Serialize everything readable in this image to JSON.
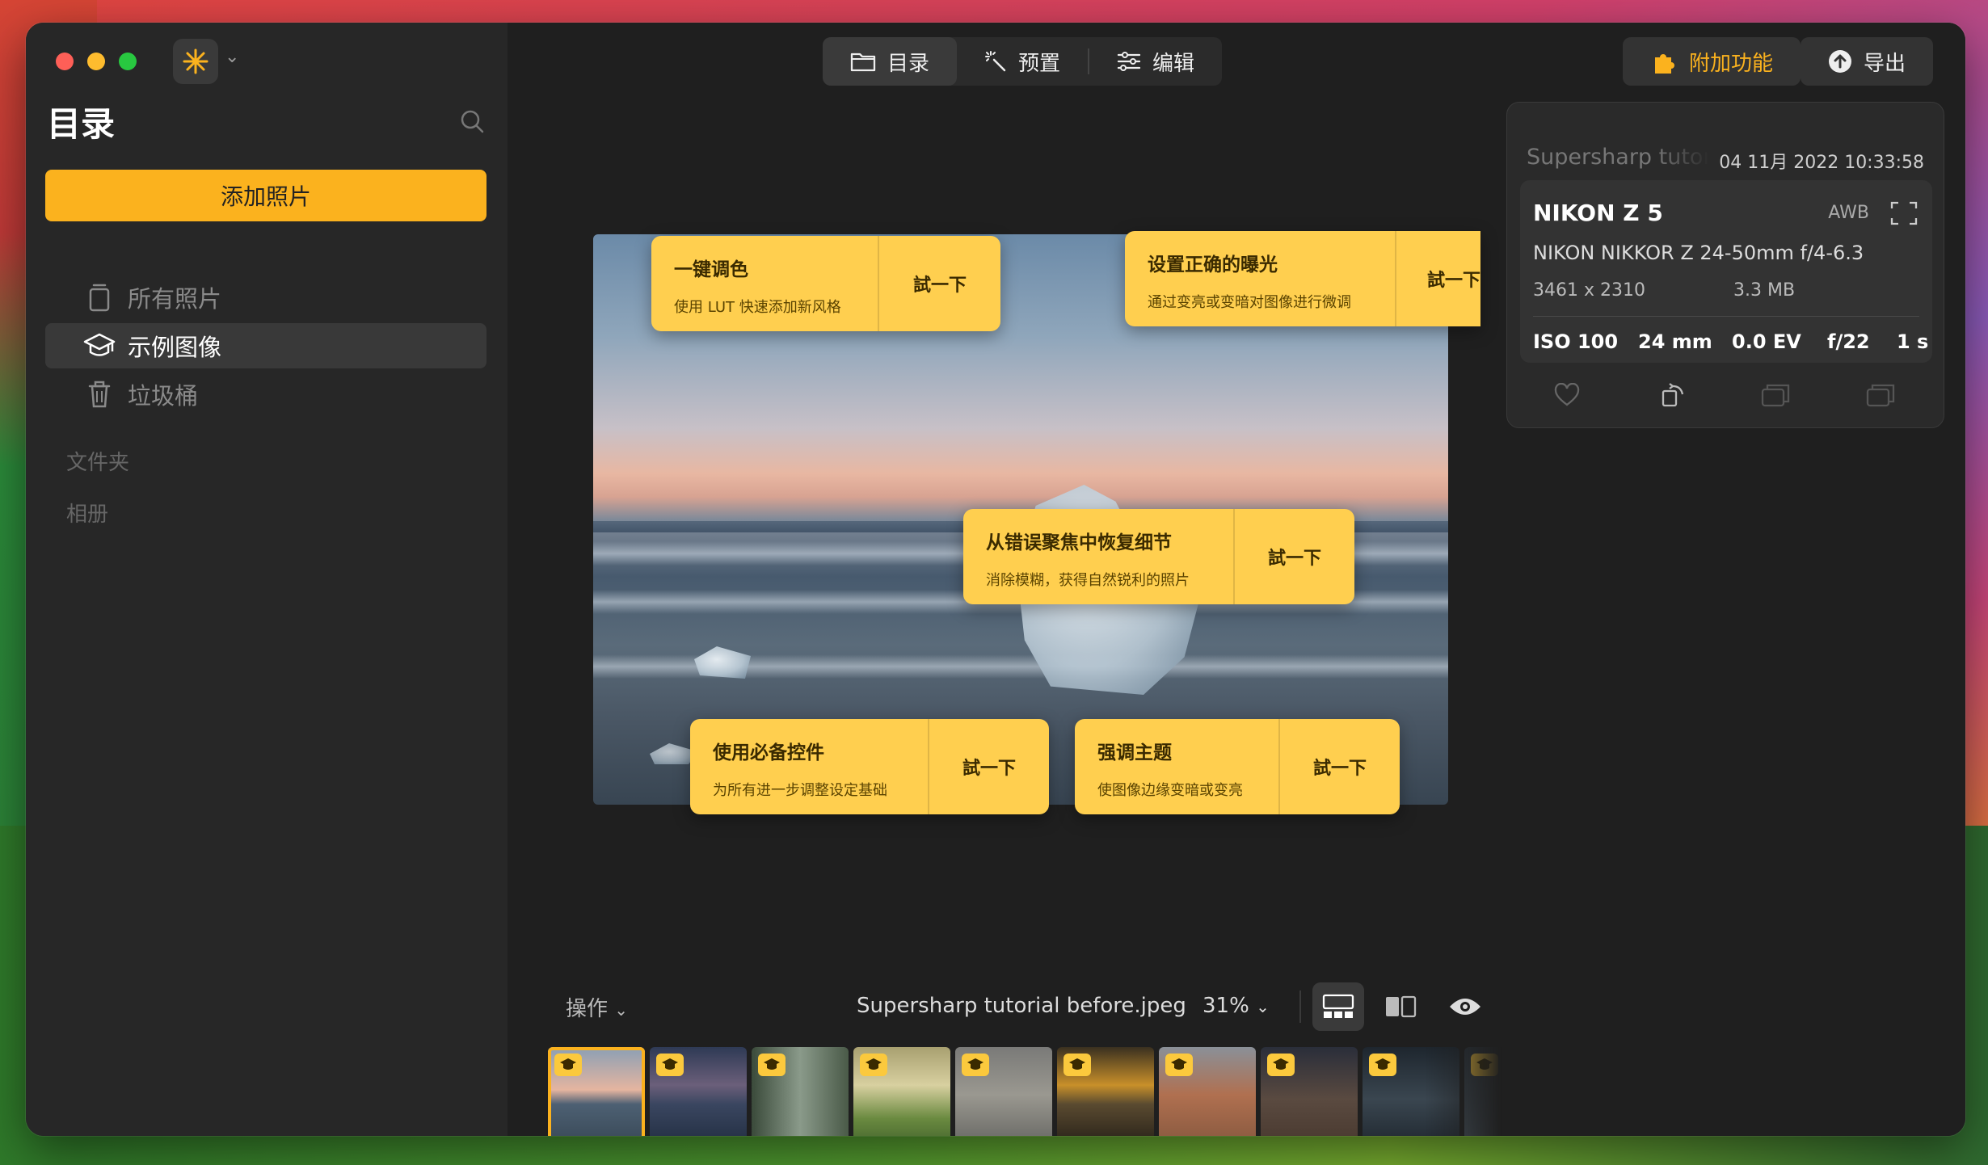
{
  "sidebar": {
    "title": "目录",
    "add_button": "添加照片",
    "items": [
      {
        "label": "所有照片",
        "icon": "photo-stack-icon",
        "active": false
      },
      {
        "label": "示例图像",
        "icon": "graduation-cap-icon",
        "active": true
      },
      {
        "label": "垃圾桶",
        "icon": "trash-icon",
        "active": false
      }
    ],
    "sections": [
      "文件夹",
      "相册"
    ]
  },
  "toolbar": {
    "tabs": [
      {
        "label": "目录",
        "icon": "folder-icon"
      },
      {
        "label": "预置",
        "icon": "magic-wand-icon"
      },
      {
        "label": "编辑",
        "icon": "sliders-icon"
      }
    ],
    "addons_label": "附加功能",
    "export_label": "导出"
  },
  "info_panel": {
    "filename": "Supersharp tutorial before.jpeg",
    "datetime": "04 11月 2022 10:33:58",
    "camera": "NIKON Z 5",
    "wb": "AWB",
    "lens": "NIKON NIKKOR Z 24-50mm f/4-6.3",
    "dimensions": "3461 x 2310",
    "filesize": "3.3 MB",
    "exif": {
      "iso": "ISO 100",
      "focal": "24 mm",
      "ev": "0.0 EV",
      "aperture": "f/22",
      "shutter": "1 s"
    }
  },
  "tips": [
    {
      "title": "一键调色",
      "subtitle": "使用 LUT 快速添加新风格",
      "button": "試一下"
    },
    {
      "title": "设置正确的曝光",
      "subtitle": "通过变亮或变暗对图像进行微调",
      "button": "試一下"
    },
    {
      "title": "从错误聚焦中恢复细节",
      "subtitle": "消除模糊，获得自然锐利的照片",
      "button": "試一下"
    },
    {
      "title": "使用必备控件",
      "subtitle": "为所有进一步调整设定基础",
      "button": "試一下"
    },
    {
      "title": "强调主题",
      "subtitle": "使图像边缘变暗或变亮",
      "button": "試一下"
    }
  ],
  "bottom": {
    "operations": "操作",
    "filename": "Supersharp tutorial before.jpeg",
    "zoom": "31%"
  },
  "colors": {
    "accent": "#fbb21e",
    "tip_bg": "#ffcf4f",
    "window_bg": "#232323"
  }
}
